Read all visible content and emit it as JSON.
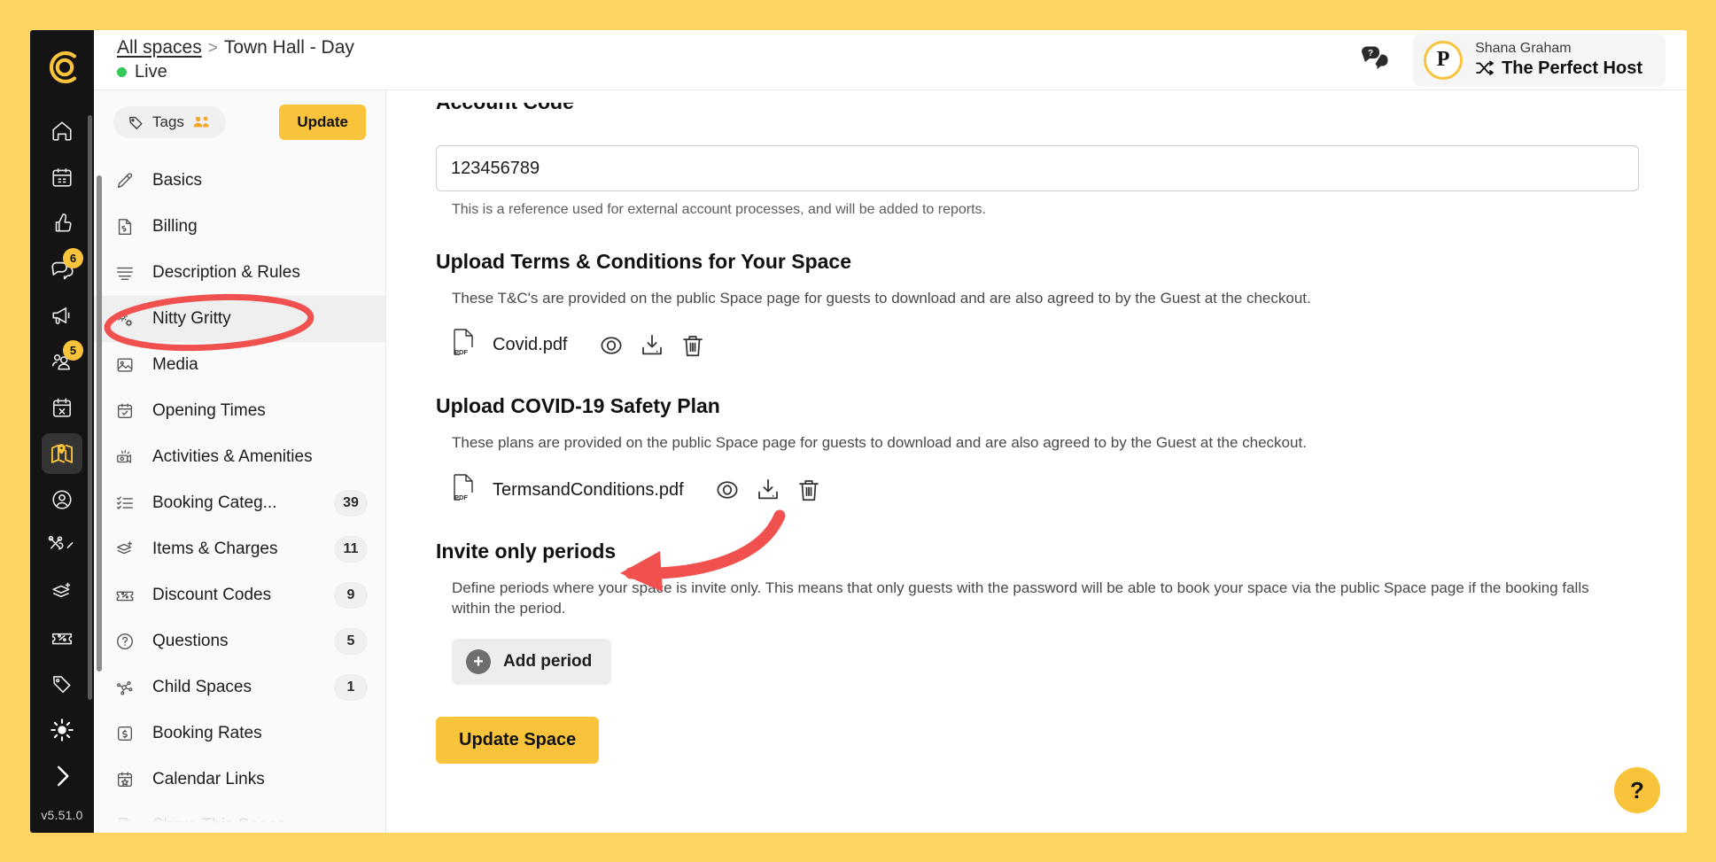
{
  "app": {
    "version_label": "v5.51.0",
    "brand_yellow": "#F9C33C",
    "accent_red": "#F04B4B",
    "live_green": "#34C759"
  },
  "rail": {
    "logo_name": "circle-c-logo",
    "items": [
      {
        "icon": "home-icon",
        "name": "rail-item-home",
        "badge": ""
      },
      {
        "icon": "calendar-icon",
        "name": "rail-item-calendar",
        "badge": ""
      },
      {
        "icon": "thumbs-up-icon",
        "name": "rail-item-reviews",
        "badge": ""
      },
      {
        "icon": "chat-icon",
        "name": "rail-item-messages",
        "badge": "6"
      },
      {
        "icon": "megaphone-icon",
        "name": "rail-item-announcements",
        "badge": ""
      },
      {
        "icon": "users-icon",
        "name": "rail-item-customers",
        "badge": "5"
      },
      {
        "icon": "calendar-x-icon",
        "name": "rail-item-blocked-dates",
        "badge": ""
      },
      {
        "icon": "map-pin-icon",
        "name": "rail-item-spaces",
        "badge": ""
      },
      {
        "icon": "user-circle-icon",
        "name": "rail-item-account",
        "badge": ""
      },
      {
        "icon": "tools-chevron-icon",
        "name": "rail-item-tools",
        "badge": ""
      },
      {
        "icon": "layers-plus-icon",
        "name": "rail-item-items",
        "badge": ""
      },
      {
        "icon": "ticket-percent-icon",
        "name": "rail-item-discounts",
        "badge": ""
      },
      {
        "icon": "tag-icon",
        "name": "rail-item-tags",
        "badge": ""
      },
      {
        "icon": "sun-icon",
        "name": "rail-item-theme",
        "badge": ""
      },
      {
        "icon": "chevron-right-icon",
        "name": "rail-item-expand",
        "badge": ""
      }
    ],
    "active_index": 7
  },
  "header": {
    "breadcrumb_root": "All spaces",
    "breadcrumb_sep": ">",
    "breadcrumb_current": "Town Hall - Day",
    "status": "Live",
    "support_icon": "chat-question-icon",
    "user": {
      "avatar_letter": "P",
      "name": "Shana Graham",
      "org": "The Perfect Host",
      "switch_icon": "shuffle-icon"
    }
  },
  "menu": {
    "tags_label": "Tags",
    "tags_icon": "tag-icon",
    "tags_people_icon": "people-icon",
    "update_label": "Update",
    "items": [
      {
        "label": "Basics",
        "icon": "pencil-icon",
        "count": ""
      },
      {
        "label": "Billing",
        "icon": "invoice-icon",
        "count": ""
      },
      {
        "label": "Description & Rules",
        "icon": "text-lines-icon",
        "count": ""
      },
      {
        "label": "Nitty Gritty",
        "icon": "gears-icon",
        "count": ""
      },
      {
        "label": "Media",
        "icon": "image-icon",
        "count": ""
      },
      {
        "label": "Opening Times",
        "icon": "calendar-check-icon",
        "count": ""
      },
      {
        "label": "Activities & Amenities",
        "icon": "projector-icon",
        "count": ""
      },
      {
        "label": "Booking Categ...",
        "icon": "checklist-icon",
        "count": "39"
      },
      {
        "label": "Items & Charges",
        "icon": "layers-plus-icon",
        "count": "11"
      },
      {
        "label": "Discount Codes",
        "icon": "ticket-percent-icon",
        "count": "9"
      },
      {
        "label": "Questions",
        "icon": "question-circle-icon",
        "count": "5"
      },
      {
        "label": "Child Spaces",
        "icon": "nodes-icon",
        "count": "1"
      },
      {
        "label": "Booking Rates",
        "icon": "dollar-box-icon",
        "count": ""
      },
      {
        "label": "Calendar Links",
        "icon": "calendar-star-icon",
        "count": ""
      },
      {
        "label": "Share This Space",
        "icon": "share-icon",
        "count": ""
      }
    ],
    "selected_index": 3
  },
  "content": {
    "account_code": {
      "title": "Account Code",
      "value": "123456789",
      "placeholder": "Account Code",
      "help": "This is a reference used for external account processes, and will be added to reports."
    },
    "terms": {
      "title": "Upload Terms & Conditions for Your Space",
      "description": "These T&C's are provided on the public Space page for guests to download and are also agreed to by the Guest at the checkout.",
      "file_name": "Covid.pdf",
      "file_type": "PDF",
      "actions": [
        "view-icon",
        "download-icon",
        "delete-icon"
      ]
    },
    "covid": {
      "title": "Upload COVID-19 Safety Plan",
      "description": "These plans are provided on the public Space page for guests to download and are also agreed to by the Guest at the checkout.",
      "file_name": "TermsandConditions.pdf",
      "file_type": "PDF",
      "actions": [
        "view-icon",
        "download-icon",
        "delete-icon"
      ]
    },
    "invite": {
      "title": "Invite only periods",
      "description": "Define periods where your space is invite only. This means that only guests with the password will be able to book your space via the public Space page if the booking falls within the period.",
      "add_label": "Add period"
    },
    "submit_label": "Update Space",
    "help_fab_label": "?"
  },
  "annotations": {
    "ellipse_target": "Nitty Gritty",
    "arrow_target": "Invite only periods",
    "color": "#F0514F"
  }
}
